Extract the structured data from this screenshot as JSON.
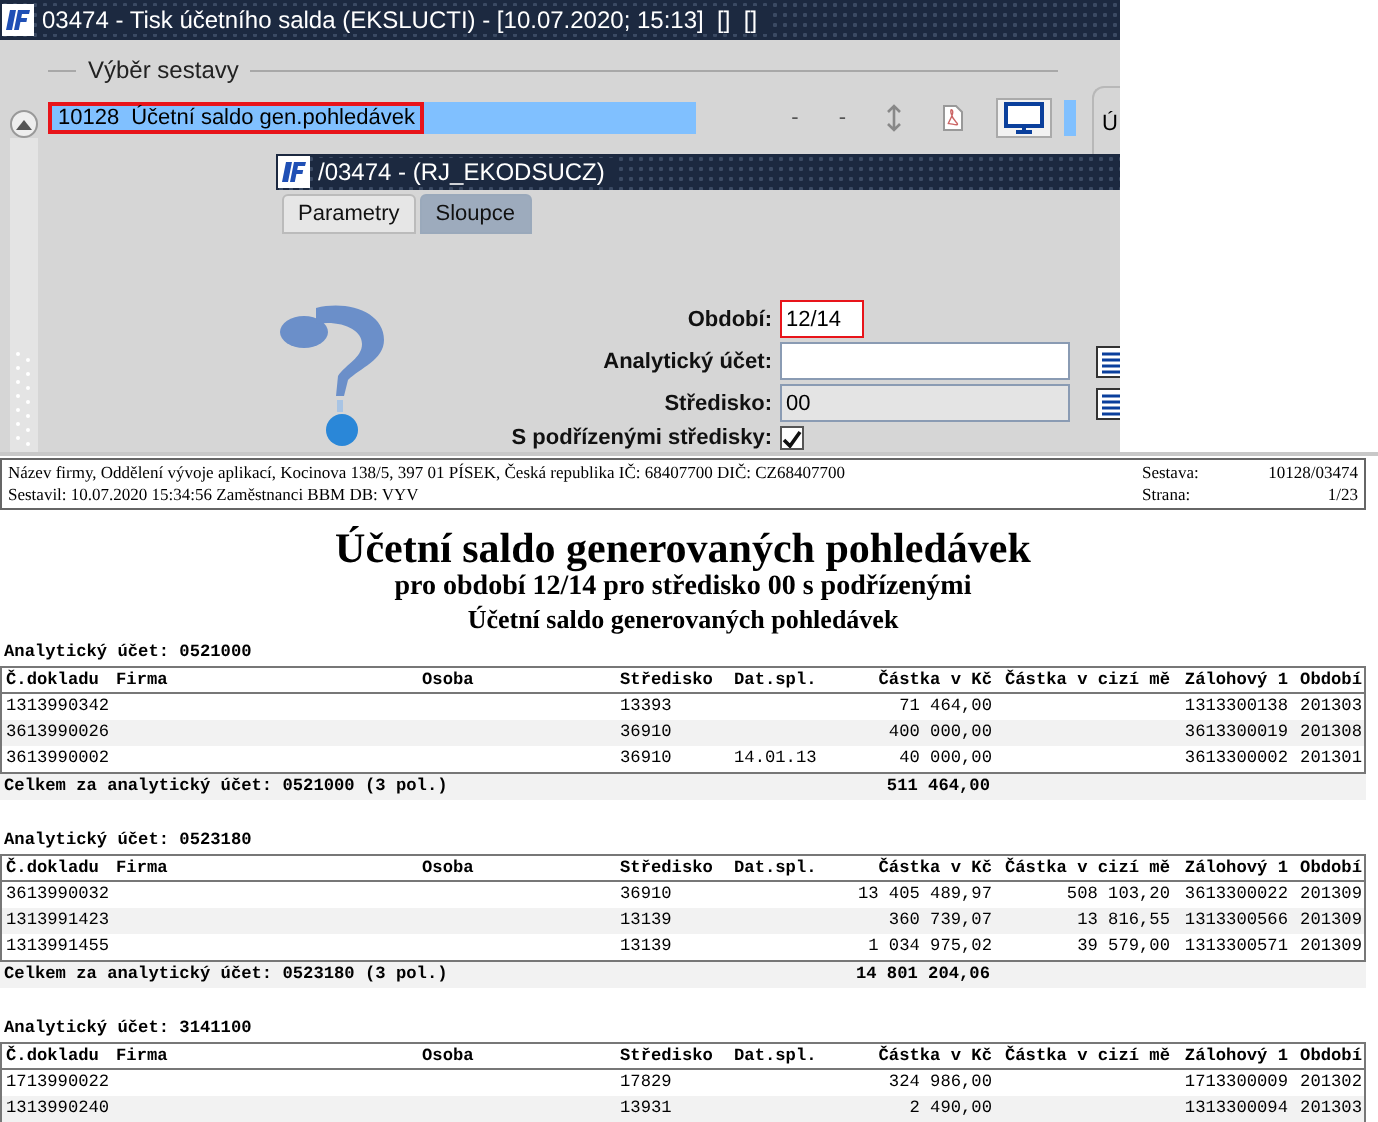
{
  "window": {
    "title": "03474 - Tisk účetního salda (EKSLUCTI) - [10.07.2020; 15:13]  []  []"
  },
  "report_selection": {
    "label": "Výběr sestavy",
    "items": [
      {
        "code": "10128",
        "name": "Účetní saldo gen.pohledávek",
        "selected": true
      }
    ],
    "toolbar": [
      {
        "kind": "text",
        "label": "-",
        "selected": false
      },
      {
        "kind": "text",
        "label": "-",
        "selected": false
      },
      {
        "kind": "resize",
        "selected": false
      },
      {
        "kind": "pdf",
        "selected": false
      },
      {
        "kind": "screen",
        "selected": true
      }
    ],
    "side_panel_label": "Ú"
  },
  "dialog": {
    "title": "/03474 - (RJ_EKODSUCZ)",
    "tabs": [
      {
        "label": "Parametry",
        "selected": true
      },
      {
        "label": "Sloupce",
        "selected": false
      }
    ],
    "fields": [
      {
        "kind": "text",
        "label": "Období:",
        "value": "12/14",
        "highlighted": true
      },
      {
        "kind": "lookup",
        "label": "Analytický účet:",
        "highlighted": false
      },
      {
        "kind": "readonly",
        "label": "Středisko:",
        "value": "00",
        "highlighted": false
      },
      {
        "kind": "checkbox",
        "label": "S podřízenými středisky:",
        "checked": true
      }
    ]
  },
  "report": {
    "header": {
      "company_line": "Název firmy, Oddělení vývoje aplikací, Kocinova 138/5, 397 01 PÍSEK, Česká republika  IČ: 68407700  DIČ: CZ68407700",
      "created_line": "Sestavil: 10.07.2020 15:34:56 Zaměstnanci BBM  DB: VYV",
      "meta": [
        {
          "label": "Sestava:",
          "value": "10128/03474"
        },
        {
          "label": "Strana:",
          "value": "1/23"
        }
      ]
    },
    "title": "Účetní saldo generovaných pohledávek",
    "subtitles": [
      "pro období 12/14 pro středisko 00 s podřízenými",
      "Účetní saldo generovaných pohledávek"
    ],
    "sections": [
      {
        "label": "Analytický účet: 0521000",
        "columns": [
          "Č.dokladu",
          "Firma",
          "Osoba",
          "Středisko",
          "Dat.spl.",
          "Částka v Kč",
          "Částka v cizí mě",
          "Zálohový 1",
          "Období"
        ],
        "rows": [
          [
            "1313990342",
            null,
            null,
            "13393",
            null,
            "71 464,00",
            null,
            "1313300138",
            "201303"
          ],
          [
            "3613990026",
            null,
            null,
            "36910",
            null,
            "400 000,00",
            null,
            "3613300019",
            "201308"
          ],
          [
            "3613990002",
            null,
            null,
            "36910",
            "14.01.13",
            "40 000,00",
            null,
            "3613300002",
            "201301"
          ]
        ],
        "total": {
          "label": "Celkem za analytický účet: 0521000 (3 pol.)",
          "amount": "511 464,00"
        }
      },
      {
        "label": "Analytický účet: 0523180",
        "columns": [
          "Č.dokladu",
          "Firma",
          "Osoba",
          "Středisko",
          "Dat.spl.",
          "Částka v Kč",
          "Částka v cizí mě",
          "Zálohový 1",
          "Období"
        ],
        "rows": [
          [
            "3613990032",
            null,
            null,
            "36910",
            null,
            "13 405 489,97",
            "508 103,20",
            "3613300022",
            "201309"
          ],
          [
            "1313991423",
            null,
            null,
            "13139",
            null,
            "360 739,07",
            "13 816,55",
            "1313300566",
            "201309"
          ],
          [
            "1313991455",
            null,
            null,
            "13139",
            null,
            "1 034 975,02",
            "39 579,00",
            "1313300571",
            "201309"
          ]
        ],
        "total": {
          "label": "Celkem za analytický účet: 0523180 (3 pol.)",
          "amount": "14 801 204,06"
        }
      },
      {
        "label": "Analytický účet: 3141100",
        "columns": [
          "Č.dokladu",
          "Firma",
          "Osoba",
          "Středisko",
          "Dat.spl.",
          "Částka v Kč",
          "Částka v cizí mě",
          "Zálohový 1",
          "Období"
        ],
        "rows": [
          [
            "1713990022",
            null,
            null,
            "17829",
            null,
            "324 986,00",
            null,
            "1713300009",
            "201302"
          ],
          [
            "1313990240",
            null,
            null,
            "13931",
            null,
            "2 490,00",
            null,
            "1313300094",
            "201303"
          ]
        ]
      }
    ]
  }
}
